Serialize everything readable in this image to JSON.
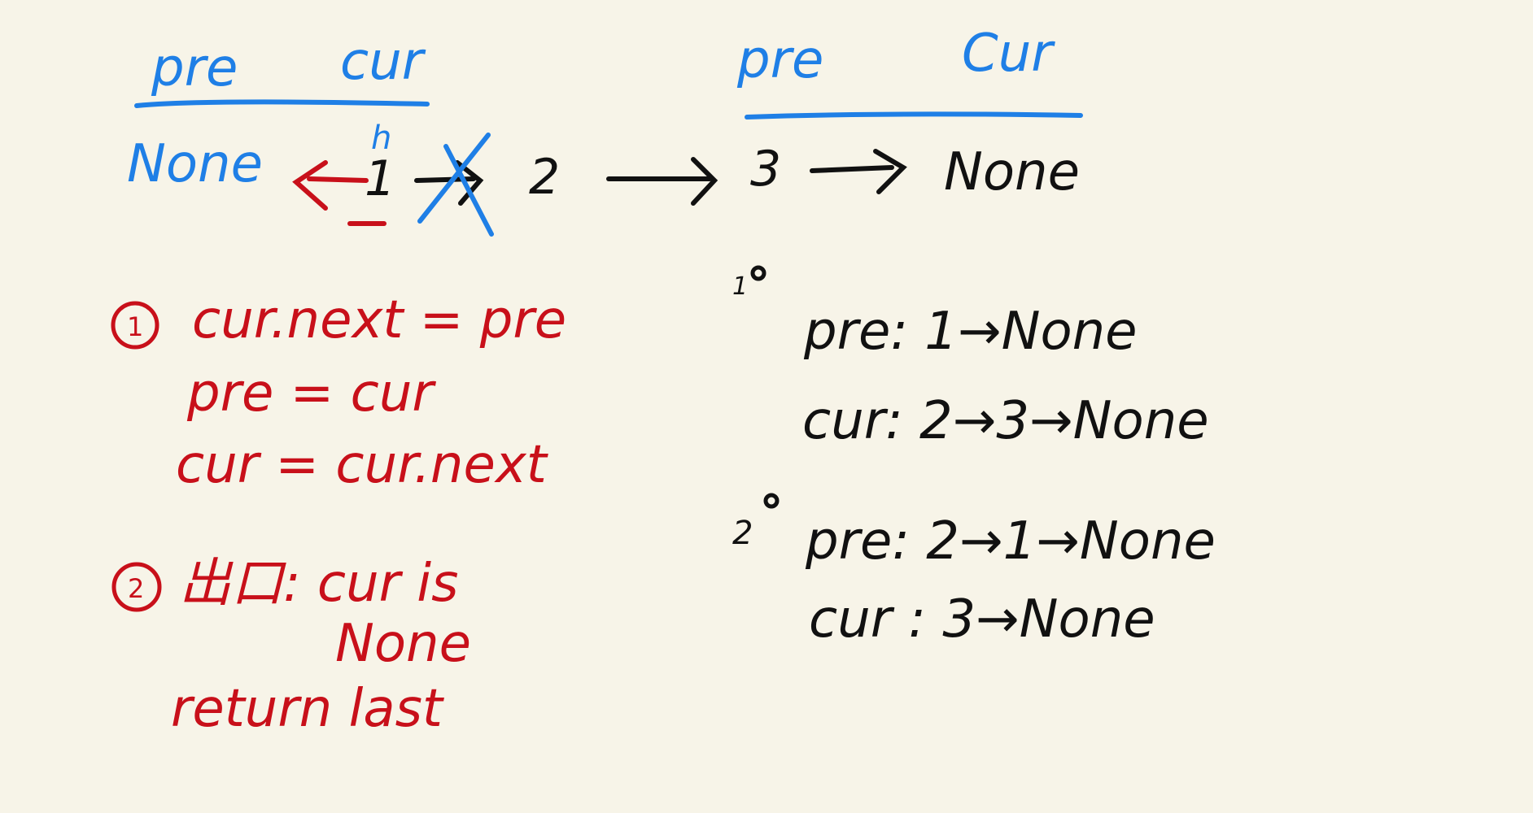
{
  "colors": {
    "background": "#f7f4e8",
    "blue": "#1f7fe6",
    "red": "#c8101a",
    "black": "#111111"
  },
  "top_left_labels": {
    "pre": "pre",
    "cur": "cur",
    "h": "h",
    "none": "None"
  },
  "top_right_labels": {
    "pre": "pre",
    "cur": "Cur"
  },
  "list": {
    "n1": "1",
    "n2": "2",
    "n3": "3",
    "tail": "None"
  },
  "steps": {
    "s1_marker": "1",
    "s1_line1": "cur.next = pre",
    "s1_line2": "pre = cur",
    "s1_line3": "cur = cur.next",
    "s2_marker": "2",
    "s2_line1": "出口: cur is",
    "s2_line2": "None",
    "s2_line3": "return last"
  },
  "iterations": {
    "i1_marker": "1",
    "i1_pre": "pre:  1→None",
    "i1_cur": "cur:  2→3→None",
    "i2_marker": "2",
    "i2_pre": "pre:  2→1→None",
    "i2_cur": "cur :  3→None"
  }
}
